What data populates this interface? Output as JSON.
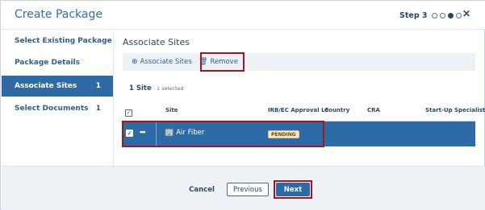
{
  "header": {
    "title": "Create Package",
    "step_label": "Step 3",
    "steps_total": 4,
    "current_step": 3,
    "close_icon": "close-icon"
  },
  "sidebar": {
    "items": [
      {
        "label": "Select Existing Package",
        "count": ""
      },
      {
        "label": "Package Details",
        "count": ""
      },
      {
        "label": "Associate Sites",
        "count": "1",
        "active": true
      },
      {
        "label": "Select Documents",
        "count": "1"
      }
    ]
  },
  "main": {
    "section_title": "Associate Sites",
    "toolbar": {
      "associate_label": "Associate Sites",
      "associate_icon": "plus-circle-icon",
      "remove_label": "Remove",
      "remove_icon": "trash-icon"
    },
    "count_label": "1 Site",
    "selected_label": "1 selected",
    "columns": [
      "Site",
      "IRB/EC Approval Le",
      "Country",
      "CRA",
      "Start-Up Specialist"
    ],
    "rows": [
      {
        "site": "Air Fiber",
        "irb_status": "PENDING",
        "country": "",
        "cra": "",
        "specialist": "",
        "selected": true
      }
    ]
  },
  "footer": {
    "cancel_label": "Cancel",
    "previous_label": "Previous",
    "next_label": "Next"
  },
  "colors": {
    "accent": "#2e6aa6",
    "highlight_outline": "#a3161c",
    "badge_bg": "#f6e6c8"
  }
}
